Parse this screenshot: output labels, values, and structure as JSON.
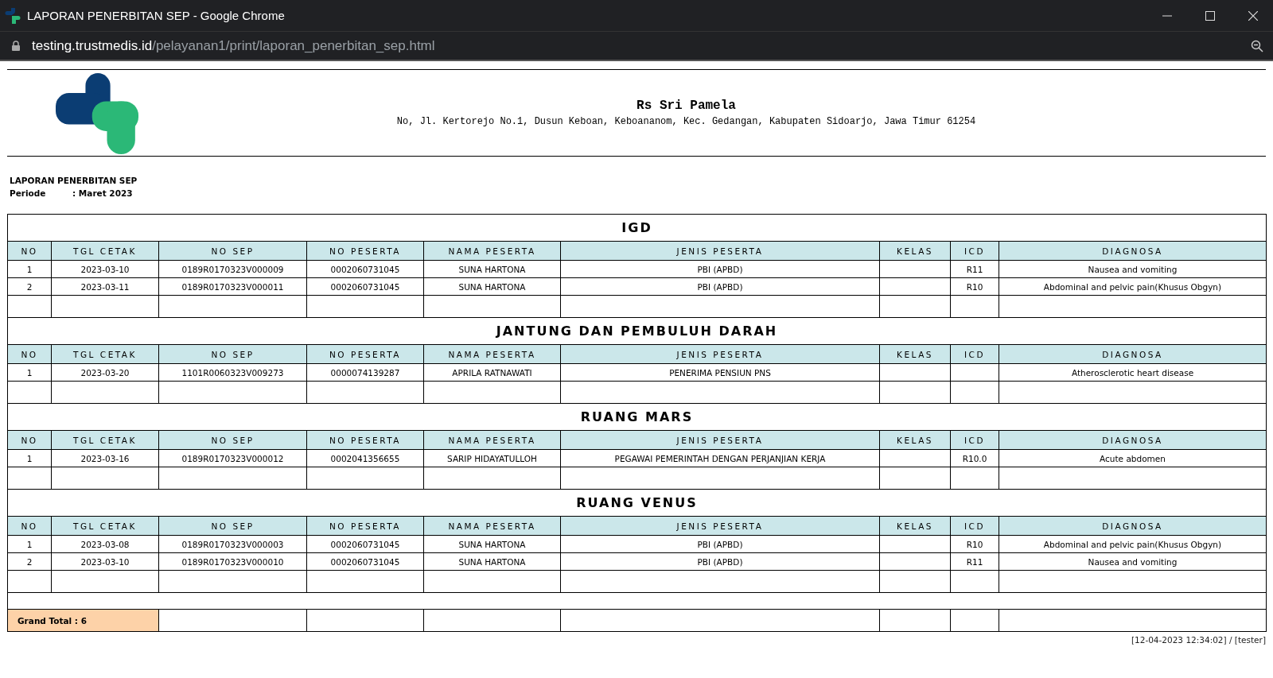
{
  "window": {
    "title": "LAPORAN PENERBITAN SEP - Google Chrome"
  },
  "address_bar": {
    "host": "testing.trustmedis.id",
    "path": "/pelayanan1/print/laporan_penerbitan_sep.html"
  },
  "header": {
    "hospital_name": "Rs Sri Pamela",
    "address": "No, Jl. Kertorejo No.1, Dusun Keboan, Keboananom, Kec. Gedangan, Kabupaten Sidoarjo, Jawa Timur 61254"
  },
  "report": {
    "title": "LAPORAN PENERBITAN SEP",
    "period_label": "Periode",
    "period_value": ": Maret 2023"
  },
  "sections": [
    {
      "name": "IGD",
      "columns": [
        "NO",
        "TGL CETAK",
        "NO SEP",
        "NO PESERTA",
        "NAMA PESERTA",
        "JENIS PESERTA",
        "KELAS",
        "ICD",
        "DIAGNOSA"
      ],
      "rows": [
        [
          "1",
          "2023-03-10",
          "0189R0170323V000009",
          "0002060731045",
          "SUNA HARTONA",
          "PBI (APBD)",
          "",
          "R11",
          "Nausea and vomiting"
        ],
        [
          "2",
          "2023-03-11",
          "0189R0170323V000011",
          "0002060731045",
          "SUNA HARTONA",
          "PBI (APBD)",
          "",
          "R10",
          "Abdominal and pelvic pain(Khusus Obgyn)"
        ]
      ]
    },
    {
      "name": "JANTUNG DAN PEMBULUH DARAH",
      "columns": [
        "NO",
        "TGL CETAK",
        "NO SEP",
        "NO PESERTA",
        "NAMA PESERTA",
        "JENIS PESERTA",
        "KELAS",
        "ICD",
        "DIAGNOSA"
      ],
      "rows": [
        [
          "1",
          "2023-03-20",
          "1101R0060323V009273",
          "0000074139287",
          "APRILA RATNAWATI",
          "PENERIMA PENSIUN PNS",
          "",
          "",
          "Atherosclerotic heart disease"
        ]
      ]
    },
    {
      "name": "RUANG MARS",
      "columns": [
        "NO",
        "TGL CETAK",
        "NO SEP",
        "NO PESERTA",
        "NAMA PESERTA",
        "JENIS PESERTA",
        "KELAS",
        "ICD",
        "DIAGNOSA"
      ],
      "rows": [
        [
          "1",
          "2023-03-16",
          "0189R0170323V000012",
          "0002041356655",
          "SARIP HIDAYATULLOH",
          "PEGAWAI PEMERINTAH DENGAN PERJANJIAN KERJA",
          "",
          "R10.0",
          "Acute abdomen"
        ]
      ]
    },
    {
      "name": "RUANG VENUS",
      "columns": [
        "NO",
        "TGL CETAK",
        "NO SEP",
        "NO PESERTA",
        "NAMA PESERTA",
        "JENIS PESERTA",
        "KELAS",
        "ICD",
        "DIAGNOSA"
      ],
      "rows": [
        [
          "1",
          "2023-03-08",
          "0189R0170323V000003",
          "0002060731045",
          "SUNA HARTONA",
          "PBI (APBD)",
          "",
          "R10",
          "Abdominal and pelvic pain(Khusus Obgyn)"
        ],
        [
          "2",
          "2023-03-10",
          "0189R0170323V000010",
          "0002060731045",
          "SUNA HARTONA",
          "PBI (APBD)",
          "",
          "R11",
          "Nausea and vomiting"
        ]
      ]
    }
  ],
  "grand_total": "Grand Total : 6",
  "footer": "[12-04-2023 12:34:02] / [tester]"
}
